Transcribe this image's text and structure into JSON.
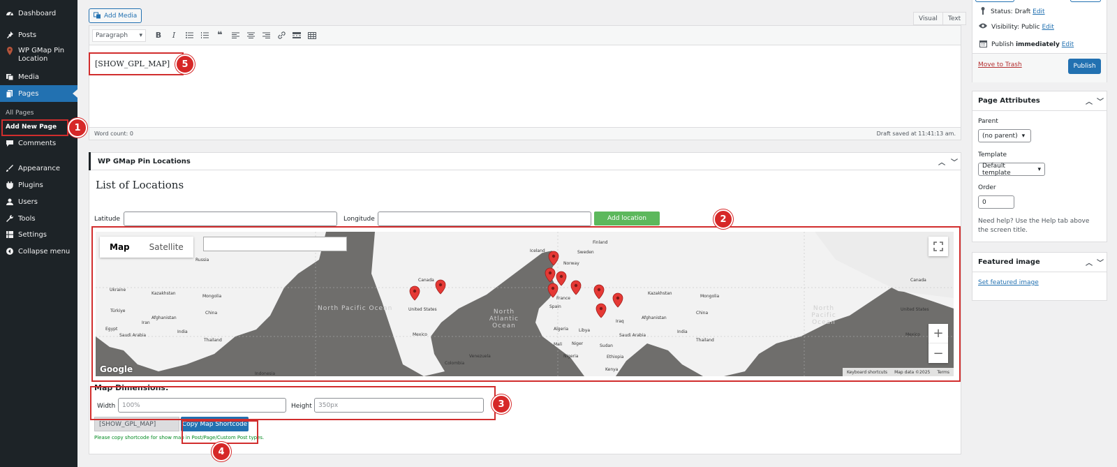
{
  "sidebar": {
    "items": [
      {
        "label": "Dashboard",
        "icon": "dashboard-icon"
      },
      {
        "label": "Posts",
        "icon": "pin-icon"
      },
      {
        "label": "WP GMap Pin Location",
        "icon": "map-pin-icon"
      },
      {
        "label": "Media",
        "icon": "media-icon"
      },
      {
        "label": "Pages",
        "icon": "pages-icon"
      },
      {
        "label": "Comments",
        "icon": "comments-icon"
      },
      {
        "label": "Appearance",
        "icon": "appearance-icon"
      },
      {
        "label": "Plugins",
        "icon": "plugins-icon"
      },
      {
        "label": "Users",
        "icon": "users-icon"
      },
      {
        "label": "Tools",
        "icon": "tools-icon"
      },
      {
        "label": "Settings",
        "icon": "settings-icon"
      },
      {
        "label": "Collapse menu",
        "icon": "collapse-icon"
      }
    ],
    "submenu": {
      "all_pages": "All Pages",
      "add_new_page": "Add New Page"
    }
  },
  "editor": {
    "add_media": "Add Media",
    "tab_visual": "Visual",
    "tab_text": "Text",
    "format": "Paragraph",
    "content": "[SHOW_GPL_MAP]",
    "word_count": "Word count: 0",
    "draft_saved": "Draft saved at 11:41:13 am."
  },
  "metabox": {
    "title": "WP GMap Pin Locations",
    "list_title": "List of Locations",
    "latitude_label": "Latitude",
    "longitude_label": "Longitude",
    "add_location": "Add location",
    "map": {
      "type_map": "Map",
      "type_satellite": "Satellite",
      "footer_shortcuts": "Keyboard shortcuts",
      "footer_data": "Map data ©2025",
      "footer_terms": "Terms",
      "logo": "Google",
      "zoom_in": "+",
      "zoom_out": "−",
      "oceans": {
        "north_pacific_left": "North Pacific Ocean",
        "north_atlantic": "North Atlantic Ocean",
        "north_pacific_right": "North Pacific Ocean"
      },
      "labels": [
        "Russia",
        "Kazakhstan",
        "Mongolia",
        "China",
        "Türkiye",
        "Iran",
        "Afghanistan",
        "Saudi Arabia",
        "Egypt",
        "India",
        "Thailand",
        "Indonesia",
        "Canada",
        "United States",
        "Mexico",
        "Venezuela",
        "Colombia",
        "Iceland",
        "Finland",
        "Sweden",
        "Norway",
        "Spain",
        "France",
        "Algeria",
        "Libya",
        "Mali",
        "Niger",
        "Nigeria",
        "Sudan",
        "Ethiopia",
        "Kenya",
        "Iraq",
        "Kazakhstan",
        "Mongolia",
        "China",
        "Afghanistan",
        "Saudi Arabia",
        "India",
        "Thailand",
        "Canada",
        "United States",
        "Mexico",
        "Ukraine",
        "Egypt"
      ]
    },
    "dimensions_title": "Map Dimensions:",
    "width_label": "Width",
    "width_value": "100%",
    "height_label": "Height",
    "height_value": "350px",
    "shortcode_value": "[SHOW_GPL_MAP]",
    "copy_button": "Copy Map Shortcode",
    "hint": "Please copy shortcode for show map in Post/Page/Custom Post types."
  },
  "publish": {
    "status_label": "Status: Draft",
    "status_edit": "Edit",
    "visibility_label": "Visibility: Public",
    "visibility_edit": "Edit",
    "publish_label": "Publish",
    "publish_when": "immediately",
    "publish_edit": "Edit",
    "trash": "Move to Trash",
    "publish_button": "Publish"
  },
  "page_attributes": {
    "title": "Page Attributes",
    "parent_label": "Parent",
    "parent_value": "(no parent)",
    "template_label": "Template",
    "template_value": "Default template",
    "order_label": "Order",
    "order_value": "0",
    "help": "Need help? Use the Help tab above the screen title."
  },
  "featured_image": {
    "title": "Featured image",
    "link": "Set featured image"
  },
  "annotations": [
    "1",
    "2",
    "3",
    "4",
    "5"
  ]
}
